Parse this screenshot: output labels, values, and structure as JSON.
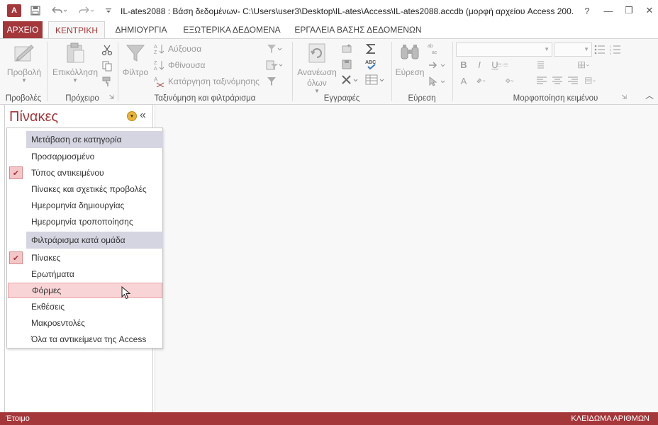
{
  "window": {
    "app_icon_label": "A",
    "title": "IL-ates2088 : Βάση δεδομένων- C:\\Users\\user3\\Desktop\\IL-ates\\Access\\IL-ates2088.accdb (μορφή αρχείου Access 200...",
    "help": "?",
    "minimize": "—",
    "restore": "❐",
    "close": "✕"
  },
  "tabs": [
    {
      "label": "ΑΡΧΕΙΟ"
    },
    {
      "label": "ΚΕΝΤΡΙΚΗ"
    },
    {
      "label": "ΔΗΜΙΟΥΡΓΙΑ"
    },
    {
      "label": "ΕΞΩΤΕΡΙΚΑ ΔΕΔΟΜΕΝΑ"
    },
    {
      "label": "ΕΡΓΑΛΕΙΑ ΒΑΣΗΣ ΔΕΔΟΜΕΝΩΝ"
    }
  ],
  "ribbon": {
    "views": {
      "label": "Προβολές",
      "view_button": "Προβολή"
    },
    "clipboard": {
      "label": "Πρόχειρο",
      "paste_button": "Επικόλληση"
    },
    "sort_filter": {
      "label": "Ταξινόμηση και φιλτράρισμα",
      "filter_button": "Φίλτρο",
      "ascending": "Αύξουσα",
      "descending": "Φθίνουσα",
      "remove_sort": "Κατάργηση ταξινόμησης"
    },
    "records": {
      "label": "Εγγραφές",
      "refresh_line1": "Ανανέωση",
      "refresh_line2": "όλων"
    },
    "find": {
      "label": "Εύρεση",
      "find_button": "Εύρεση"
    },
    "text_format": {
      "label": "Μορφοποίηση κειμένου",
      "bold": "B",
      "italic": "I",
      "underline": "U",
      "font_color": "A"
    }
  },
  "nav": {
    "title": "Πίνακες",
    "collapse": "«"
  },
  "menu": {
    "header_category": "Μετάβαση σε κατηγορία",
    "categories": [
      {
        "label": "Προσαρμοσμένο",
        "checked": false
      },
      {
        "label": "Τύπος αντικειμένου",
        "checked": true
      },
      {
        "label": "Πίνακες και σχετικές προβολές",
        "checked": false
      },
      {
        "label": "Ημερομηνία δημιουργίας",
        "checked": false
      },
      {
        "label": "Ημερομηνία τροποποίησης",
        "checked": false
      }
    ],
    "header_filter": "Φιλτράρισμα κατά ομάδα",
    "filters": [
      {
        "label": "Πίνακες",
        "checked": true
      },
      {
        "label": "Ερωτήματα",
        "checked": false
      },
      {
        "label": "Φόρμες",
        "checked": false,
        "hover": true
      },
      {
        "label": "Εκθέσεις",
        "checked": false
      },
      {
        "label": "Μακροεντολές",
        "checked": false
      },
      {
        "label": "Όλα τα αντικείμενα της Access",
        "checked": false
      }
    ],
    "check_mark": "✔"
  },
  "status": {
    "left": "Έτοιμο",
    "right": "ΚΛΕΙΔΩΜΑ ΑΡΙΘΜΩΝ"
  },
  "colors": {
    "accent": "#a4373a",
    "menu_header": "#d5d5e2",
    "hover": "#f8d4d6"
  }
}
